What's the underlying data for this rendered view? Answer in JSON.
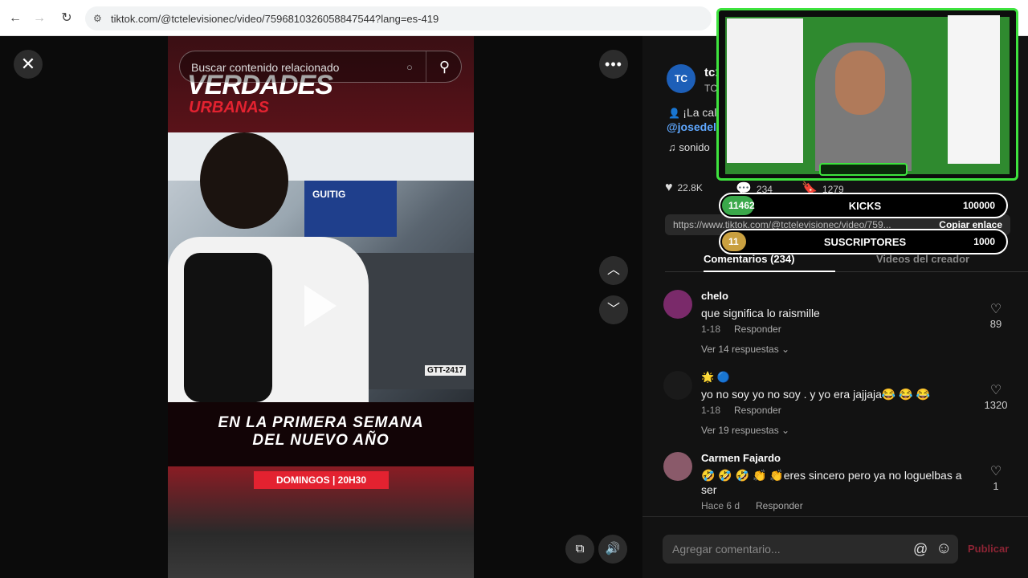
{
  "browser": {
    "url": "tiktok.com/@tctelevisionec/video/7596810326058847544?lang=es-419"
  },
  "video": {
    "search_placeholder": "Buscar contenido relacionado",
    "brand_line1": "VERDADES",
    "brand_line2": "URBANAS",
    "caption_line1": "EN LA PRIMERA SEMANA",
    "caption_line2": "DEL NUEVO AÑO",
    "schedule_tag": "DOMINGOS | 20H30",
    "bus_sign": "GUITIG",
    "plate": "GTT-2417"
  },
  "author": {
    "avatar_text": "TC",
    "name": "tc1",
    "sub": "TC",
    "desc": "¡La cal",
    "mention": "@josedel",
    "sound": "sonido"
  },
  "stats": {
    "likes": "22.8K",
    "comments": "234",
    "saves": "1279"
  },
  "link": {
    "url": "https://www.tiktok.com/@tctelevisionec/video/759...",
    "copy_label": "Copiar enlace"
  },
  "tabs": {
    "comments": "Comentarios (234)",
    "creator": "Videos del creador"
  },
  "comments": [
    {
      "name": "chelo",
      "text": "que significa lo raismille",
      "date": "1-18",
      "reply": "Responder",
      "likes": "89",
      "more": "Ver 14 respuestas ⌄",
      "avatar_color": "#7a2a6a"
    },
    {
      "name": "🌟 🔵",
      "text": "yo no soy yo no soy . y yo era jajjaja😂 😂 😂",
      "date": "1-18",
      "reply": "Responder",
      "likes": "1320",
      "more": "Ver 19 respuestas ⌄",
      "avatar_color": "#1a1a1a"
    },
    {
      "name": "Carmen Fajardo",
      "text": "🤣 🤣 🤣 👏 👏eres sincero pero ya no loguelbas a ser",
      "date": "Hace 6 d",
      "reply": "Responder",
      "likes": "1",
      "avatar_color": "#8a5a6a"
    }
  ],
  "input": {
    "placeholder": "Agregar comentario...",
    "post": "Publicar"
  },
  "hud": {
    "kicks_current": "11462",
    "kicks_label": "KICKS",
    "kicks_goal": "100000",
    "subs_current": "11",
    "subs_label": "SUSCRIPTORES",
    "subs_goal": "1000",
    "kicks_color": "#3aa84a",
    "subs_color": "#c9a040"
  }
}
